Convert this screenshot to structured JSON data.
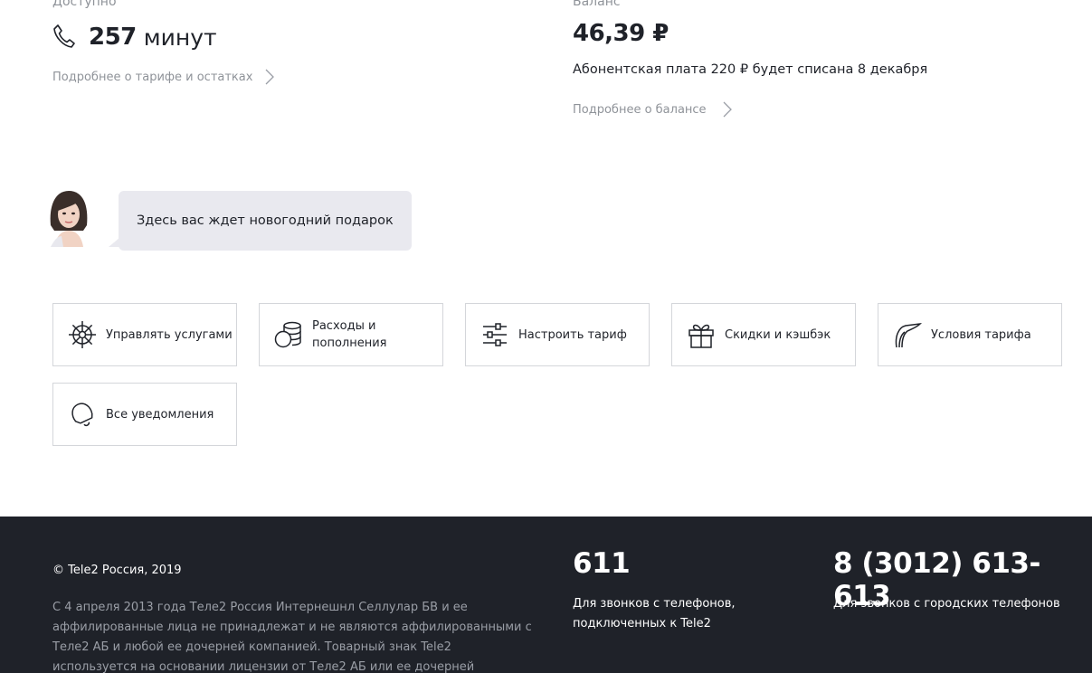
{
  "tariff": {
    "label": "Доступно",
    "minutes_value": "257",
    "minutes_unit": "минут",
    "more_link": "Подробнее о тарифе и остатках",
    "icon": "phone-icon"
  },
  "balance": {
    "label": "Баланс",
    "amount": "46,39 ₽",
    "fee_text": "Абонентская плата 220 ₽ будет списана 8 декабря",
    "more_link": "Подробнее о балансе"
  },
  "chat": {
    "message": "Здесь вас ждет новогодний подарок"
  },
  "actions": [
    {
      "label": "Управлять услугами",
      "icon": "helm-icon"
    },
    {
      "label": "Расходы и пополнения",
      "icon": "coins-icon"
    },
    {
      "label": "Настроить тариф",
      "icon": "sliders-icon"
    },
    {
      "label": "Скидки и кэшбэк",
      "icon": "gift-icon"
    },
    {
      "label": "Условия тарифа",
      "icon": "conditions-icon"
    },
    {
      "label": "Все уведомления",
      "icon": "bell-icon"
    }
  ],
  "footer": {
    "copyright": "© Tele2 Россия, 2019",
    "disclaimer": "С 4 апреля 2013 года Теле2 Россия Интернешнл Селлулар БВ и ее аффилированные лица не принадлежат и не являются аффилированными с Теле2 АБ и любой ее дочерней компанией. Товарный знак Tele2 используется на основании лицензии от Теле2 АБ или ее дочерней компании.",
    "short_number": "611",
    "short_number_desc": "Для звонков с телефонов, подключенных к Tele2",
    "city_number": "8 (3012) 613-613",
    "city_number_desc": "Для звонков с городских телефонов"
  },
  "colors": {
    "footer_bg": "#1f2229",
    "bubble_bg": "#e9e9ef",
    "muted_text": "#8f9399",
    "tile_border": "#d4d6da"
  }
}
